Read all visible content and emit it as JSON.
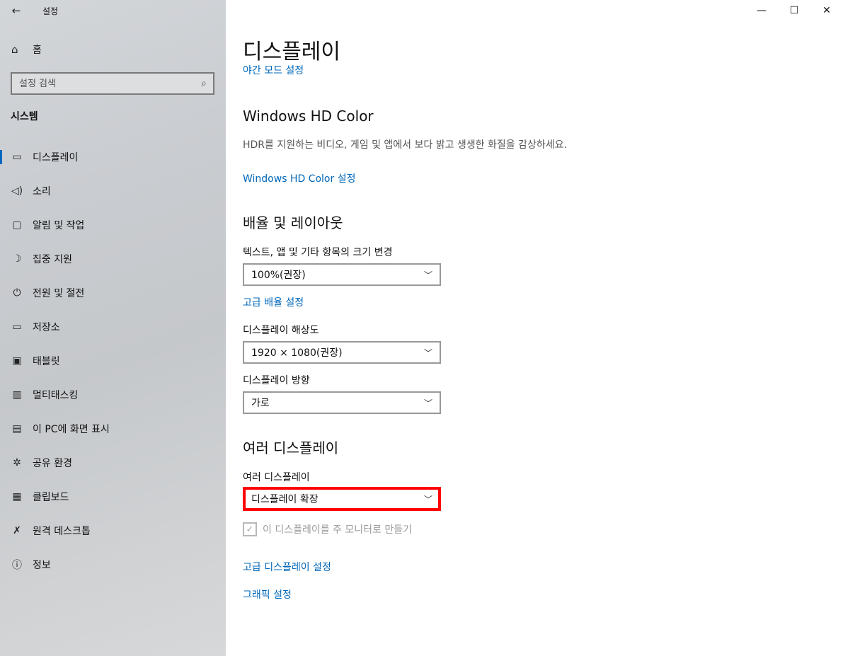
{
  "window": {
    "title": "설정",
    "back_icon": "←",
    "minimize_icon": "—",
    "maximize_icon": "☐",
    "close_icon": "✕"
  },
  "sidebar": {
    "home_icon": "⌂",
    "home_label": "홈",
    "search_placeholder": "설정 검색",
    "search_icon": "⌕",
    "section_title": "시스템",
    "items": [
      {
        "icon": "▭",
        "label": "디스플레이",
        "active": true
      },
      {
        "icon": "◁)",
        "label": "소리"
      },
      {
        "icon": "▢",
        "label": "알림 및 작업"
      },
      {
        "icon": "☽",
        "label": "집중 지원"
      },
      {
        "icon": "⏻",
        "label": "전원 및 절전"
      },
      {
        "icon": "▭",
        "label": "저장소"
      },
      {
        "icon": "▣",
        "label": "태블릿"
      },
      {
        "icon": "▥",
        "label": "멀티태스킹"
      },
      {
        "icon": "▤",
        "label": "이 PC에 화면 표시"
      },
      {
        "icon": "✲",
        "label": "공유 환경"
      },
      {
        "icon": "▦",
        "label": "클립보드"
      },
      {
        "icon": "✗",
        "label": "원격 데스크톱"
      },
      {
        "icon": "ⓘ",
        "label": "정보"
      }
    ]
  },
  "main": {
    "page_title": "디스플레이",
    "cut_link": "야간 모드 설정",
    "hd_color": {
      "title": "Windows HD Color",
      "description": "HDR를 지원하는 비디오, 게임 및 앱에서 보다 밝고 생생한 화질을 감상하세요.",
      "link": "Windows HD Color 설정"
    },
    "scale_layout": {
      "title": "배율 및 레이아웃",
      "scale_label": "텍스트, 앱 및 기타 항목의 크기 변경",
      "scale_value": "100%(권장)",
      "advanced_scale_link": "고급 배율 설정",
      "resolution_label": "디스플레이 해상도",
      "resolution_value": "1920 × 1080(권장)",
      "orientation_label": "디스플레이 방향",
      "orientation_value": "가로"
    },
    "multiple_displays": {
      "title": "여러 디스플레이",
      "label": "여러 디스플레이",
      "value": "디스플레이 확장",
      "checkbox_label": "이 디스플레이를 주 모니터로 만들기",
      "checkbox_checked": true,
      "advanced_link": "고급 디스플레이 설정",
      "graphics_link": "그래픽 설정"
    },
    "chevron": "﹀",
    "check_mark": "✓"
  }
}
